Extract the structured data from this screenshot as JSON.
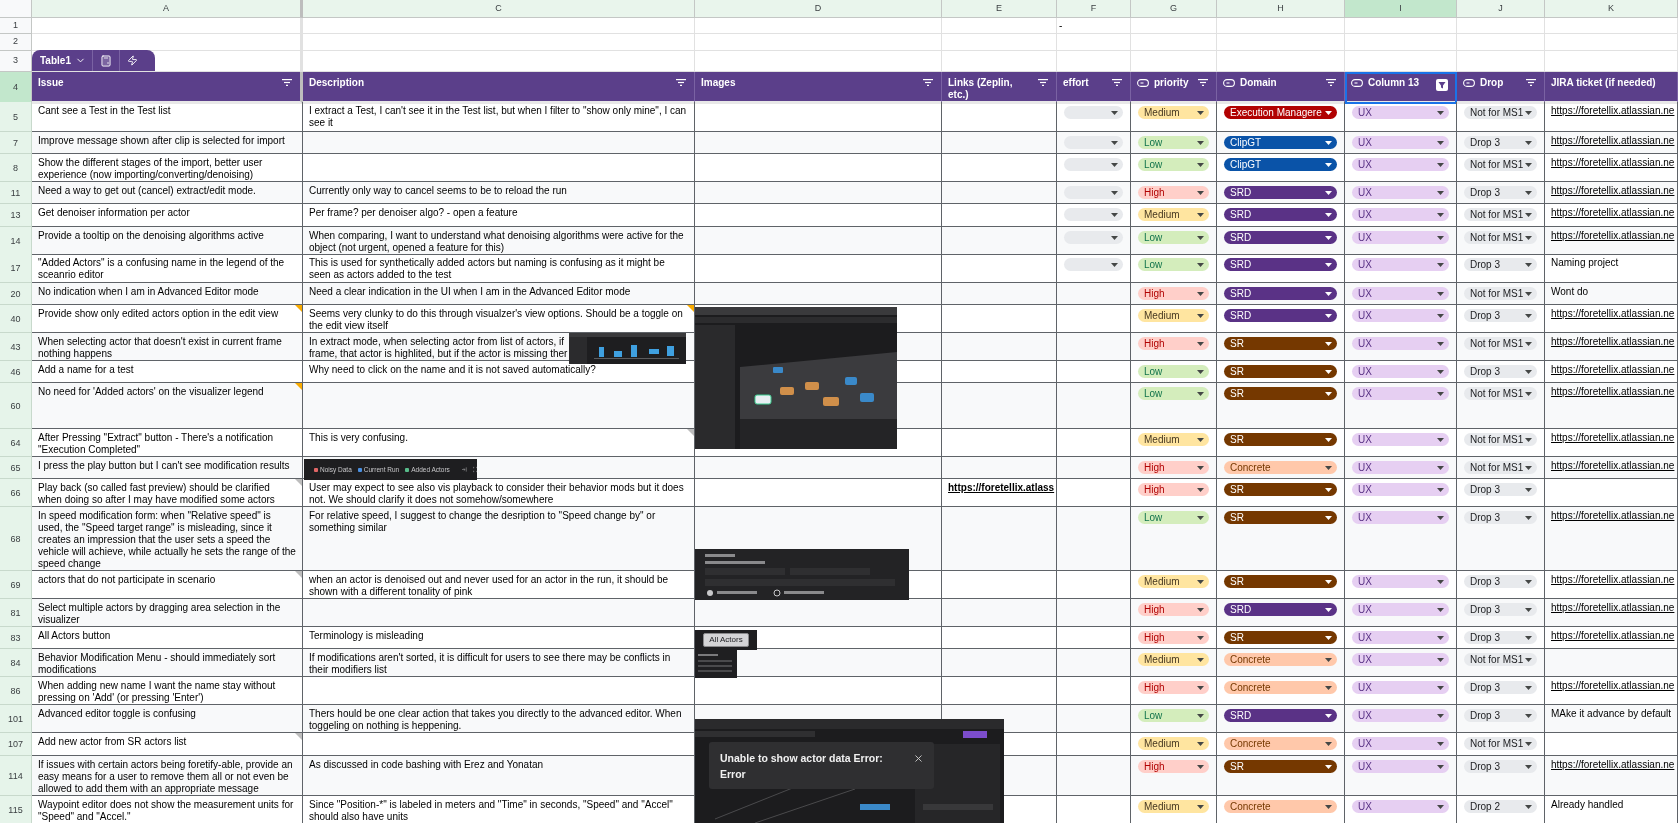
{
  "column_headers": [
    {
      "letter": "A",
      "selected": false
    },
    {
      "letter": "C",
      "selected": false
    },
    {
      "letter": "D",
      "selected": false
    },
    {
      "letter": "E",
      "selected": false
    },
    {
      "letter": "F",
      "selected": false
    },
    {
      "letter": "G",
      "selected": false
    },
    {
      "letter": "H",
      "selected": false
    },
    {
      "letter": "I",
      "selected": true
    },
    {
      "letter": "J",
      "selected": false
    },
    {
      "letter": "K",
      "selected": false
    }
  ],
  "top_rows": [
    {
      "number": "1",
      "f": "-"
    },
    {
      "number": "2"
    },
    {
      "number": "3"
    }
  ],
  "table_tab": {
    "name": "Table1"
  },
  "header": {
    "number": "4",
    "columns": [
      {
        "label": "Issue",
        "chip_type": false,
        "selected": false,
        "filtered": false
      },
      {
        "label": "Description",
        "chip_type": false,
        "selected": false,
        "filtered": false
      },
      {
        "label": "Images",
        "chip_type": false,
        "selected": false,
        "filtered": false
      },
      {
        "label": "Links (Zeplin, etc.)",
        "chip_type": false,
        "selected": false,
        "filtered": false
      },
      {
        "label": "effort",
        "chip_type": false,
        "selected": false,
        "filtered": false
      },
      {
        "label": "priority",
        "chip_type": true,
        "selected": false,
        "filtered": false
      },
      {
        "label": "Domain",
        "chip_type": true,
        "selected": false,
        "filtered": false
      },
      {
        "label": "Column 13",
        "chip_type": true,
        "selected": true,
        "filtered": true
      },
      {
        "label": "Drop",
        "chip_type": true,
        "selected": false,
        "filtered": false
      },
      {
        "label": "JIRA ticket (if needed)",
        "chip_type": false,
        "selected": false
      }
    ]
  },
  "rows": [
    {
      "number": "5",
      "issue": "Cant see a Test in the Test list",
      "description": "I extract a Test, I can't see it in the Test list, but when I filter to \"show only mine\", I can see it",
      "effort_dropdown": true,
      "priority": {
        "text": "Medium",
        "color": "#ffe5a0"
      },
      "domain": {
        "text": "Execution Managere",
        "color": "#b10202"
      },
      "column_13": {
        "text": "UX",
        "color": "#e6cff2"
      },
      "drop": {
        "text": "Not for MS1",
        "color": "#e8eaed"
      },
      "jira": {
        "text": "https://foretellix.atlassian.ne",
        "link": true
      }
    },
    {
      "number": "7",
      "issue": "Improve message shown after clip is selected for import",
      "effort_dropdown": true,
      "priority": {
        "text": "Low",
        "color": "#d4edbc"
      },
      "domain": {
        "text": "ClipGT",
        "color": "#0a53a8"
      },
      "column_13": {
        "text": "UX",
        "color": "#e6cff2"
      },
      "drop": {
        "text": "Drop 3",
        "color": "#e8eaed"
      },
      "jira": {
        "text": "https://foretellix.atlassian.ne",
        "link": true
      }
    },
    {
      "number": "8",
      "issue": "Show the different stages of the import, better user experience (now importing/converting/denoising)",
      "effort_dropdown": true,
      "priority": {
        "text": "Low",
        "color": "#d4edbc"
      },
      "domain": {
        "text": "ClipGT",
        "color": "#0a53a8"
      },
      "column_13": {
        "text": "UX",
        "color": "#e6cff2"
      },
      "drop": {
        "text": "Not for MS1",
        "color": "#e8eaed"
      },
      "jira": {
        "text": "https://foretellix.atlassian.ne",
        "link": true
      }
    },
    {
      "number": "11",
      "issue": "Need a way to get out (cancel) extract/edit mode.",
      "description": "Currently only way to cancel seems to be to reload the run",
      "effort_dropdown": true,
      "priority": {
        "text": "High",
        "color": "#ffcfc9"
      },
      "domain": {
        "text": "SRD",
        "color": "#5a3286"
      },
      "column_13": {
        "text": "UX",
        "color": "#e6cff2"
      },
      "drop": {
        "text": "Drop 3",
        "color": "#e8eaed"
      },
      "jira": {
        "text": "https://foretellix.atlassian.ne",
        "link": true
      }
    },
    {
      "number": "13",
      "issue": "Get denoiser information per actor",
      "description": "Per frame? per denoiser algo? - open a feature",
      "effort_dropdown": true,
      "priority": {
        "text": "Medium",
        "color": "#ffe5a0"
      },
      "domain": {
        "text": "SRD",
        "color": "#5a3286"
      },
      "column_13": {
        "text": "UX",
        "color": "#e6cff2"
      },
      "drop": {
        "text": "Not for MS1",
        "color": "#e8eaed"
      },
      "jira": {
        "text": "https://foretellix.atlassian.ne",
        "link": true
      }
    },
    {
      "number": "14",
      "issue": "Provide a tooltip on the denoising algorithms active",
      "description": "When comparing, I want to understand what denoising algorithms were active for the object (not urgent, opened a feature for this)",
      "effort_dropdown": true,
      "priority": {
        "text": "Low",
        "color": "#d4edbc"
      },
      "domain": {
        "text": "SRD",
        "color": "#5a3286"
      },
      "column_13": {
        "text": "UX",
        "color": "#e6cff2"
      },
      "drop": {
        "text": "Not for MS1",
        "color": "#e8eaed"
      },
      "jira": {
        "text": "https://foretellix.atlassian.ne",
        "link": true
      }
    },
    {
      "number": "17",
      "issue": "\"Added Actors\" is a confusing name in the legend of the sceanrio editor",
      "description": "This is used for synthetically added actors but naming is confusing as it might be seen as actors added to the test",
      "effort_dropdown": true,
      "priority": {
        "text": "Low",
        "color": "#d4edbc"
      },
      "domain": {
        "text": "SRD",
        "color": "#5a3286"
      },
      "column_13": {
        "text": "UX",
        "color": "#e6cff2"
      },
      "drop": {
        "text": "Drop 3",
        "color": "#e8eaed"
      },
      "jira": {
        "text": "Naming project",
        "link": false
      }
    },
    {
      "number": "20",
      "issue": "No indication when I am in Advanced Editor mode",
      "description": "Need a clear indication in the UI when I am in the Advanced Editor mode",
      "effort_dropdown": false,
      "priority": {
        "text": "High",
        "color": "#ffcfc9"
      },
      "domain": {
        "text": "SRD",
        "color": "#5a3286"
      },
      "column_13": {
        "text": "UX",
        "color": "#e6cff2"
      },
      "drop": {
        "text": "Not for MS1",
        "color": "#e8eaed"
      },
      "jira": {
        "text": "Wont do",
        "link": false
      }
    },
    {
      "number": "40",
      "issue": "Provide show only edited actors option in the edit view",
      "issue_note": {
        "color": "#f9ab00"
      },
      "description": "Seems very clunky to do this through visualzer's view options. Should be a toggle on the edit view itself",
      "description_note": {
        "color": "#f9ab00"
      },
      "effort_dropdown": false,
      "priority": {
        "text": "Medium",
        "color": "#ffe5a0"
      },
      "domain": {
        "text": "SRD",
        "color": "#5a3286"
      },
      "column_13": {
        "text": "UX",
        "color": "#e6cff2"
      },
      "drop": {
        "text": "Drop 3",
        "color": "#e8eaed"
      },
      "jira": {
        "text": "https://foretellix.atlassian.ne",
        "link": true
      },
      "image": {
        "kind": "visualizer"
      }
    },
    {
      "number": "43",
      "issue": "When selecting actor that doesn't exist in current frame nothing happens",
      "description_lines": [
        "In extract mode, when selecting actor from list of actors, if",
        "frame, that actor is highlited, but if the actor is missing ther"
      ],
      "effort_dropdown": false,
      "priority": {
        "text": "High",
        "color": "#ffcfc9"
      },
      "domain": {
        "text": "SR",
        "color": "#753800"
      },
      "column_13": {
        "text": "UX",
        "color": "#e6cff2"
      },
      "drop": {
        "text": "Not for MS1",
        "color": "#e8eaed"
      },
      "jira": {
        "text": "https://foretellix.atlassian.ne",
        "link": true
      },
      "image": {
        "kind": "thumbnail"
      }
    },
    {
      "number": "46",
      "issue": "Add a name for a test",
      "description": "Why need to click on the name and it is not saved automatically?",
      "effort_dropdown": false,
      "priority": {
        "text": "Low",
        "color": "#d4edbc"
      },
      "domain": {
        "text": "SR",
        "color": "#753800"
      },
      "column_13": {
        "text": "UX",
        "color": "#e6cff2"
      },
      "drop": {
        "text": "Drop 3",
        "color": "#e8eaed"
      },
      "jira": {
        "text": "https://foretellix.atlassian.ne",
        "link": true
      }
    },
    {
      "number": "60",
      "issue": "No need for 'Added actors' on the visualizer legend",
      "issue_note": {
        "color": "#f9ab00"
      },
      "effort_dropdown": false,
      "priority": {
        "text": "Low",
        "color": "#d4edbc"
      },
      "domain": {
        "text": "SR",
        "color": "#753800"
      },
      "column_13": {
        "text": "UX",
        "color": "#e6cff2"
      },
      "drop": {
        "text": "Not for MS1",
        "color": "#e8eaed"
      },
      "jira": {
        "text": "https://foretellix.atlassian.ne",
        "link": true
      }
    },
    {
      "number": "64",
      "issue": "After Pressing \"Extract\" button - There's a notification \"Execution Completed\"",
      "description": "This is very confusing.",
      "description_note": {
        "color": "#bdbdbd"
      },
      "effort_dropdown": false,
      "priority": {
        "text": "Medium",
        "color": "#ffe5a0"
      },
      "domain": {
        "text": "SR",
        "color": "#753800"
      },
      "column_13": {
        "text": "UX",
        "color": "#e6cff2"
      },
      "drop": {
        "text": "Not for MS1",
        "color": "#e8eaed"
      },
      "jira": {
        "text": "https://foretellix.atlassian.ne",
        "link": true
      }
    },
    {
      "number": "65",
      "issue": "I press the play button but I can't see modification results",
      "effort_dropdown": false,
      "priority": {
        "text": "High",
        "color": "#ffcfc9"
      },
      "domain": {
        "text": "Concrete",
        "color": "#ffc8aa"
      },
      "column_13": {
        "text": "UX",
        "color": "#e6cff2"
      },
      "drop": {
        "text": "Not for MS1",
        "color": "#e8eaed"
      },
      "jira": {
        "text": "https://foretellix.atlassian.ne",
        "link": true
      },
      "image": {
        "kind": "legend",
        "items": [
          {
            "label": "Noisy Data",
            "color": "#e06666"
          },
          {
            "label": "Current Run",
            "color": "#4a90e2"
          },
          {
            "label": "Added Actors",
            "color": "#57bb8a"
          }
        ]
      }
    },
    {
      "number": "66",
      "issue": "Play back (so called fast preview) should be clarified when doing so after I may have modified some actors",
      "issue_note": {
        "color": "#bdbdbd"
      },
      "description": "User may expect to see also vis playback to consider their behavior mods but it does not.  We should clarify it does not somehow/somewhere",
      "link": "https://foretellix.atlass",
      "effort_dropdown": false,
      "priority": {
        "text": "High",
        "color": "#ffcfc9"
      },
      "domain": {
        "text": "SR",
        "color": "#753800"
      },
      "column_13": {
        "text": "UX",
        "color": "#e6cff2"
      },
      "drop": {
        "text": "Drop 3",
        "color": "#e8eaed"
      }
    },
    {
      "number": "68",
      "issue": "In speed modification form: when \"Relative speed\" is used, the \"Speed target range\" is misleading, since it creates an impression that the user sets a speed the vehicle will achieve, while actually he sets the range of the speed change",
      "description": "For relative speed, I suggest to change the desription to \"Speed change by\" or something similar",
      "effort_dropdown": false,
      "priority": {
        "text": "Low",
        "color": "#d4edbc"
      },
      "domain": {
        "text": "SR",
        "color": "#753800"
      },
      "column_13": {
        "text": "UX",
        "color": "#e6cff2"
      },
      "drop": {
        "text": "Drop 3",
        "color": "#e8eaed"
      },
      "jira": {
        "text": "https://foretellix.atlassian.ne",
        "link": true
      },
      "image": {
        "kind": "speed_form"
      }
    },
    {
      "number": "69",
      "issue": "actors that do not participate in scenario",
      "issue_note": {
        "color": "#bdbdbd"
      },
      "description": "when an actor is denoised out and never used for an actor in the run, it should be shown with a different tonality of pink",
      "effort_dropdown": false,
      "priority": {
        "text": "Medium",
        "color": "#ffe5a0"
      },
      "domain": {
        "text": "SR",
        "color": "#753800"
      },
      "column_13": {
        "text": "UX",
        "color": "#e6cff2"
      },
      "drop": {
        "text": "Drop 3",
        "color": "#e8eaed"
      },
      "jira": {
        "text": "https://foretellix.atlassian.ne",
        "link": true
      }
    },
    {
      "number": "81",
      "issue": "Select multiple actors by dragging area selection in the visualizer",
      "effort_dropdown": false,
      "priority": {
        "text": "High",
        "color": "#ffcfc9"
      },
      "domain": {
        "text": "SRD",
        "color": "#5a3286"
      },
      "column_13": {
        "text": "UX",
        "color": "#e6cff2"
      },
      "drop": {
        "text": "Drop 3",
        "color": "#e8eaed"
      },
      "jira": {
        "text": "https://foretellix.atlassian.ne",
        "link": true
      }
    },
    {
      "number": "83",
      "issue": "All Actors button",
      "description": "Terminology is misleading",
      "effort_dropdown": false,
      "priority": {
        "text": "High",
        "color": "#ffcfc9"
      },
      "domain": {
        "text": "SR",
        "color": "#753800"
      },
      "column_13": {
        "text": "UX",
        "color": "#e6cff2"
      },
      "drop": {
        "text": "Drop 3",
        "color": "#e8eaed"
      },
      "jira": {
        "text": "https://foretellix.atlassian.ne",
        "link": true
      },
      "image": {
        "kind": "button",
        "label": "All Actors"
      }
    },
    {
      "number": "84",
      "issue": "Behavior Modification Menu - should immediately sort modifications",
      "description": "If modifications aren't sorted, it is difficult for users to see there may be conflicts in their modifiers list",
      "effort_dropdown": false,
      "priority": {
        "text": "Medium",
        "color": "#ffe5a0"
      },
      "domain": {
        "text": "Concrete",
        "color": "#ffc8aa"
      },
      "column_13": {
        "text": "UX",
        "color": "#e6cff2"
      },
      "drop": {
        "text": "Not for MS1",
        "color": "#e8eaed"
      },
      "image": {
        "kind": "panel"
      }
    },
    {
      "number": "86",
      "issue": "When adding new name I want the name stay without pressing on 'Add' (or pressing 'Enter')",
      "effort_dropdown": false,
      "priority": {
        "text": "High",
        "color": "#ffcfc9"
      },
      "domain": {
        "text": "Concrete",
        "color": "#ffc8aa"
      },
      "column_13": {
        "text": "UX",
        "color": "#e6cff2"
      },
      "drop": {
        "text": "Drop 3",
        "color": "#e8eaed"
      },
      "jira": {
        "text": "https://foretellix.atlassian.ne",
        "link": true
      }
    },
    {
      "number": "101",
      "issue": "Advanced editor toggle is confusing",
      "description": "Thers hould be one clear action that takes you directly to the advanced editor. When toggeling on nothing is heppening.",
      "effort_dropdown": false,
      "priority": {
        "text": "Low",
        "color": "#d4edbc"
      },
      "domain": {
        "text": "SRD",
        "color": "#5a3286"
      },
      "column_13": {
        "text": "UX",
        "color": "#e6cff2"
      },
      "drop": {
        "text": "Drop 3",
        "color": "#e8eaed"
      },
      "jira": {
        "text": "MAke it advance by default",
        "link": false
      },
      "image": {
        "kind": "toast",
        "message": "Unable to show actor data Error: Error"
      }
    },
    {
      "number": "107",
      "issue": "Add new actor from SR actors list",
      "issue_note": {
        "color": "#bdbdbd"
      },
      "effort_dropdown": false,
      "priority": {
        "text": "Medium",
        "color": "#ffe5a0"
      },
      "domain": {
        "text": "Concrete",
        "color": "#ffc8aa"
      },
      "column_13": {
        "text": "UX",
        "color": "#e6cff2"
      },
      "drop": {
        "text": "Not for MS1",
        "color": "#e8eaed"
      }
    },
    {
      "number": "114",
      "issue": "If issues with certain actors being foretify-able, provide an easy means for a user to remove them all or not even be allowed to add them with an appropriate message",
      "description": "As discussed in code bashing with Erez and Yonatan",
      "effort_dropdown": false,
      "priority": {
        "text": "High",
        "color": "#ffcfc9"
      },
      "domain": {
        "text": "SR",
        "color": "#753800"
      },
      "column_13": {
        "text": "UX",
        "color": "#e6cff2"
      },
      "drop": {
        "text": "Drop 3",
        "color": "#e8eaed"
      },
      "jira": {
        "text": "https://foretellix.atlassian.ne",
        "link": true
      }
    },
    {
      "number": "115",
      "issue": "Waypoint editor does not show the measurement units for \"Speed\" and \"Accel.\"",
      "description": "Since \"Position-*\" is labeled in meters and \"Time\" in seconds, \"Speed\" and \"Accel\" should also have units",
      "effort_dropdown": false,
      "priority": {
        "text": "Medium",
        "color": "#ffe5a0"
      },
      "domain": {
        "text": "Concrete",
        "color": "#ffc8aa"
      },
      "column_13": {
        "text": "UX",
        "color": "#e6cff2"
      },
      "drop": {
        "text": "Drop 2",
        "color": "#e8eaed"
      },
      "jira": {
        "text": "Already handled",
        "link": false
      }
    }
  ]
}
